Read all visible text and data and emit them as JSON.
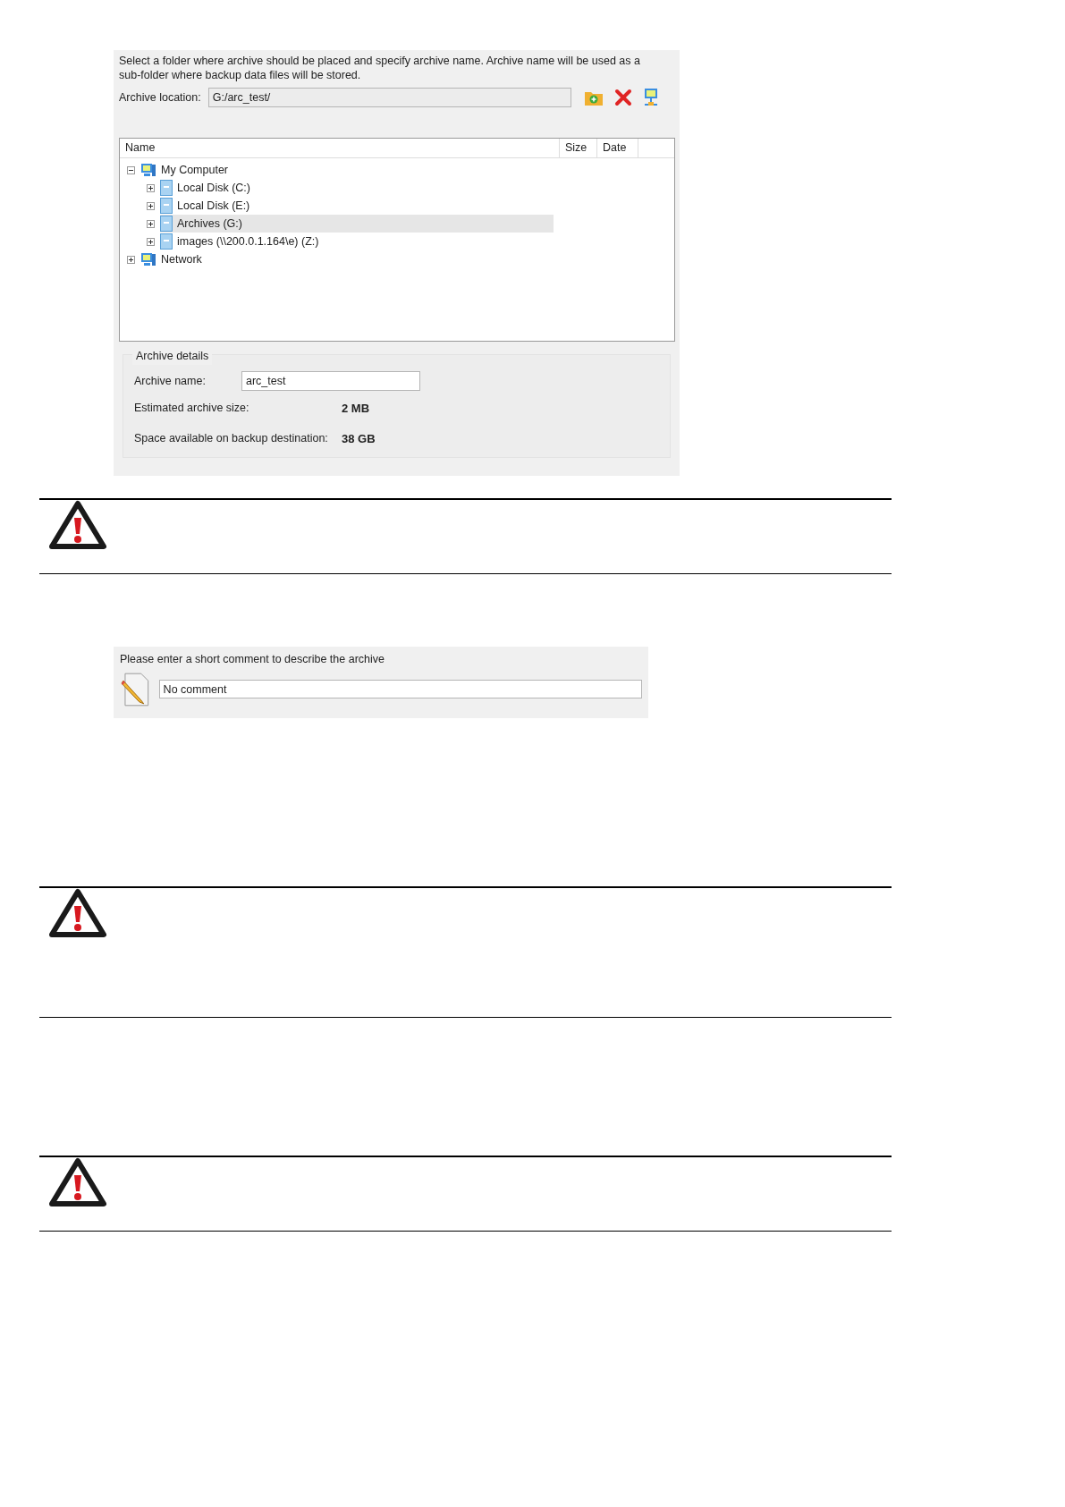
{
  "archive_dialog": {
    "description": "Select a folder where archive should be placed and specify archive name. Archive name will be used as a sub-folder where backup data files will be stored.",
    "location": {
      "label": "Archive location:",
      "value": "G:/arc_test/"
    },
    "tree": {
      "columns": [
        "Name",
        "Size",
        "Date"
      ],
      "items": [
        {
          "kind": "computer",
          "label": "My Computer",
          "expanded": true,
          "selected": false,
          "children": [
            {
              "kind": "drive",
              "label": "Local Disk (C:)",
              "expanded": false,
              "selected": false
            },
            {
              "kind": "drive",
              "label": "Local Disk (E:)",
              "expanded": false,
              "selected": false
            },
            {
              "kind": "drive",
              "label": "Archives (G:)",
              "expanded": false,
              "selected": true
            },
            {
              "kind": "drive",
              "label": "images (\\\\200.0.1.164\\e) (Z:)",
              "expanded": false,
              "selected": false
            }
          ]
        },
        {
          "kind": "computer",
          "label": "Network",
          "expanded": false,
          "selected": false
        }
      ]
    },
    "details": {
      "title": "Archive details",
      "name_label": "Archive name:",
      "name_value": "arc_test",
      "size_label": "Estimated archive size:",
      "size_value": "2 MB",
      "space_label": "Space available on backup destination:",
      "space_value": "38 GB"
    }
  },
  "comment_dialog": {
    "prompt": "Please enter a short comment to describe the archive",
    "value": "No comment"
  },
  "notes": [
    {
      "kind": "warning"
    },
    {
      "kind": "warning"
    },
    {
      "kind": "warning"
    }
  ]
}
